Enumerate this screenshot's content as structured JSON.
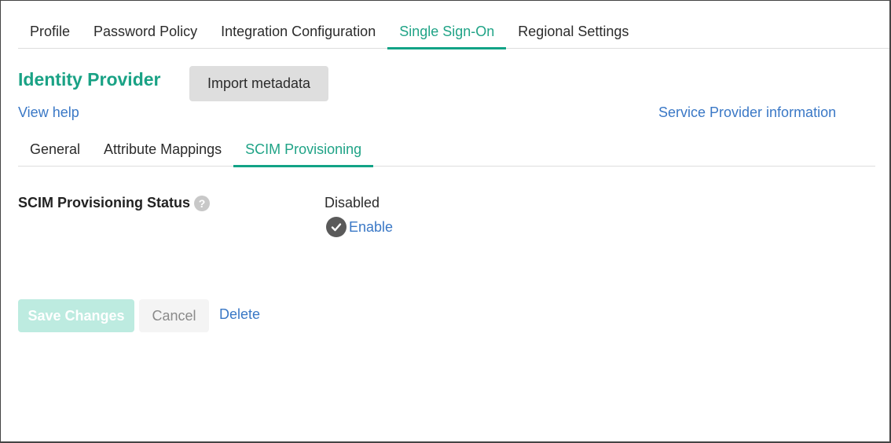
{
  "top_tabs": [
    {
      "label": "Profile",
      "active": false
    },
    {
      "label": "Password Policy",
      "active": false
    },
    {
      "label": "Integration Configuration",
      "active": false
    },
    {
      "label": "Single Sign-On",
      "active": true
    },
    {
      "label": "Regional Settings",
      "active": false
    }
  ],
  "header": {
    "title": "Identity Provider",
    "import_button": "Import metadata",
    "view_help": "View help",
    "service_provider_info": "Service Provider information"
  },
  "sub_tabs": [
    {
      "label": "General",
      "active": false
    },
    {
      "label": "Attribute Mappings",
      "active": false
    },
    {
      "label": "SCIM Provisioning",
      "active": true
    }
  ],
  "scim": {
    "label": "SCIM Provisioning Status",
    "help_icon": "question-circle-icon",
    "help_glyph": "?",
    "status": "Disabled",
    "enable_icon": "check-circle-icon",
    "enable_label": "Enable"
  },
  "actions": {
    "save": "Save Changes",
    "cancel": "Cancel",
    "delete": "Delete"
  },
  "colors": {
    "accent": "#12a386",
    "link": "#3a78c6",
    "save_disabled_bg": "#bdebe0"
  }
}
